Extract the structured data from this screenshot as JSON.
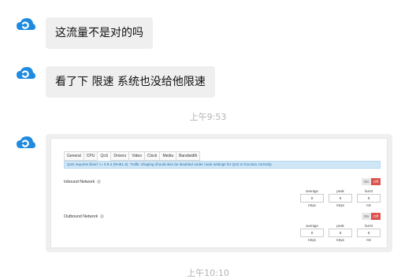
{
  "messages": [
    {
      "type": "text",
      "text": "这流量不是对的吗"
    },
    {
      "type": "text",
      "text": "看了下 限速 系统也没给他限速"
    }
  ],
  "timestamps": [
    "上午9:53",
    "上午10:10"
  ],
  "screenshot": {
    "tabs": [
      "General",
      "CPU",
      "QoS",
      "Drivers",
      "Video",
      "Clock",
      "Media",
      "Bandwidth"
    ],
    "active_tab": "QoS",
    "notice": "QoS requires libvirt >= 0.9.4 (RHEL 6). Traffic Shaping should also be disabled under node settings for QoS to function correctly.",
    "inbound": {
      "label": "Inbound Network",
      "help": "?",
      "toggle": {
        "on": "On",
        "off": "Off"
      },
      "headers": [
        "average",
        "peak",
        "burst"
      ],
      "values": [
        "0",
        "0",
        "0"
      ],
      "units": [
        "KBps",
        "KBps",
        "KB"
      ]
    },
    "outbound": {
      "label": "Outbound Network",
      "help": "?",
      "toggle": {
        "on": "On",
        "off": "Off"
      },
      "headers": [
        "average",
        "peak",
        "burst"
      ],
      "values": [
        "0",
        "0",
        "0"
      ],
      "units": [
        "KBps",
        "KBps",
        "KB"
      ]
    }
  },
  "colors": {
    "avatar": "#1f8be0",
    "bubble": "#efefef",
    "timestamp": "#b3b3b3",
    "toggle_off": "#d9534f",
    "notice_bg": "#cfe6f7"
  },
  "icons": {
    "avatar": "cloud-logo-icon"
  }
}
